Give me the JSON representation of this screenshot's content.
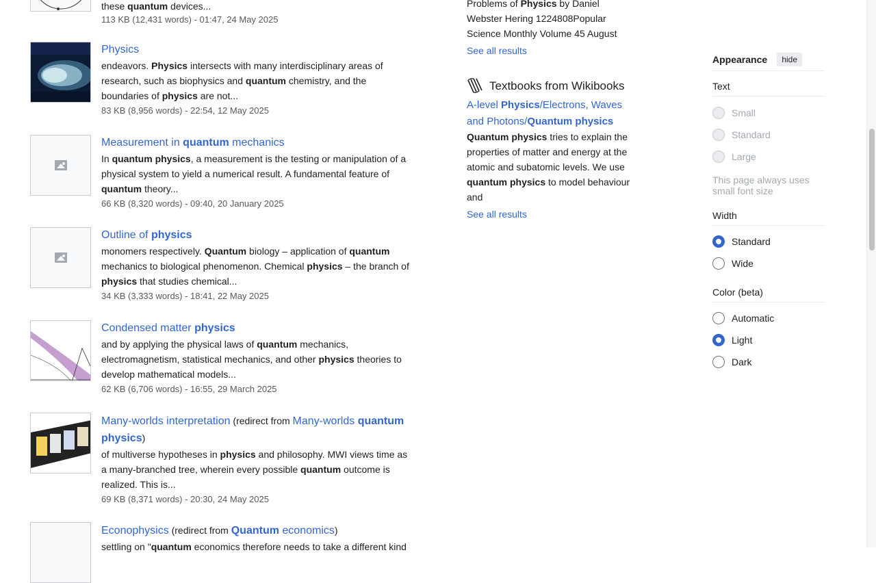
{
  "results": {
    "top": {
      "snippet_a": "these ",
      "snippet_b": "quantum",
      "snippet_c": " devices...",
      "meta": "113 KB (12,431 words) - 01:47, 24 May 2025"
    },
    "physics": {
      "title": "Physics",
      "s1": "endeavors. ",
      "s2": "Physics",
      "s3": " intersects with many interdisciplinary areas of research, such as biophysics and ",
      "s4": "quantum",
      "s5": " chemistry, and the boundaries of ",
      "s6": "physics",
      "s7": " are not...",
      "meta": "83 KB (8,956 words) - 22:54, 12 May 2025"
    },
    "measurement": {
      "t1": "Measurement in ",
      "t2": "quantum",
      "t3": " mechanics",
      "s1": "In ",
      "s2": "quantum physics",
      "s3": ", a measurement is the testing or manipulation of a physical system to yield a numerical result. A fundamental feature of ",
      "s4": "quantum",
      "s5": " theory...",
      "meta": "66 KB (8,320 words) - 09:40, 20 January 2025"
    },
    "outline": {
      "t1": "Outline of ",
      "t2": "physics",
      "s1": "monomers respectively. ",
      "s2": "Quantum",
      "s3": " biology – application of ",
      "s4": "quantum",
      "s5": " mechanics to biological phenomenon. Chemical ",
      "s6": "physics",
      "s7": " – the branch of ",
      "s8": "physics",
      "s9": " that studies chemical...",
      "meta": "34 KB (3,333 words) - 18:41, 22 May 2025"
    },
    "condensed": {
      "t1": "Condensed matter ",
      "t2": "physics",
      "s1": "and by applying the physical laws of ",
      "s2": "quantum",
      "s3": " mechanics, electromagnetism, statistical mechanics, and other ",
      "s4": "physics",
      "s5": " theories to develop mathematical models...",
      "meta": "62 KB (6,706 words) - 16:55, 29 March 2025"
    },
    "manyworlds": {
      "title": "Many-worlds interpretation",
      "redir_pre": " (redirect from ",
      "r1": "Many-worlds ",
      "r2": "quantum physics",
      "redir_post": ")",
      "s1": "of multiverse hypotheses in ",
      "s2": "physics",
      "s3": " and philosophy. MWI views time as a many-branched tree, wherein every possible ",
      "s4": "quantum",
      "s5": " outcome is realized. This is...",
      "meta": "69 KB (8,371 words) - 20:30, 24 May 2025"
    },
    "econophysics": {
      "title": "Econophysics",
      "redir_pre": " (redirect from ",
      "r1": "Quantum",
      "r2": " economics",
      "redir_post": ")",
      "s1": "settling on \"",
      "s2": "quantum",
      "s3": " economics therefore needs to take a different kind"
    }
  },
  "sister": {
    "wikisource": {
      "s1": "Problems of ",
      "s2": "Physics",
      "s3": " by Daniel Webster Hering 1224808Popular Science Monthly Volume 45 August",
      "see_all": "See all results"
    },
    "wikibooks": {
      "heading": "Textbooks from Wikibooks",
      "t1": "A-level ",
      "t2": "Physics",
      "t3": "/Electrons, Waves and Photons/",
      "t4": "Quantum physics",
      "s1": "Quantum physics",
      "s2": " tries to explain the properties of matter and energy at the atomic and subatomic levels. We use ",
      "s3": "quantum physics",
      "s4": " to model behaviour and",
      "see_all": "See all results"
    }
  },
  "appearance": {
    "title": "Appearance",
    "hide": "hide",
    "text_label": "Text",
    "text_options": [
      "Small",
      "Standard",
      "Large"
    ],
    "text_note": "This page always uses small font size",
    "width_label": "Width",
    "width_options": [
      "Standard",
      "Wide"
    ],
    "width_selected": "Standard",
    "color_label": "Color (beta)",
    "color_options": [
      "Automatic",
      "Light",
      "Dark"
    ],
    "color_selected": "Light"
  },
  "colors": {
    "link": "#3366cc",
    "text": "#202122",
    "meta": "#54595d",
    "accent": "#3366cc"
  }
}
